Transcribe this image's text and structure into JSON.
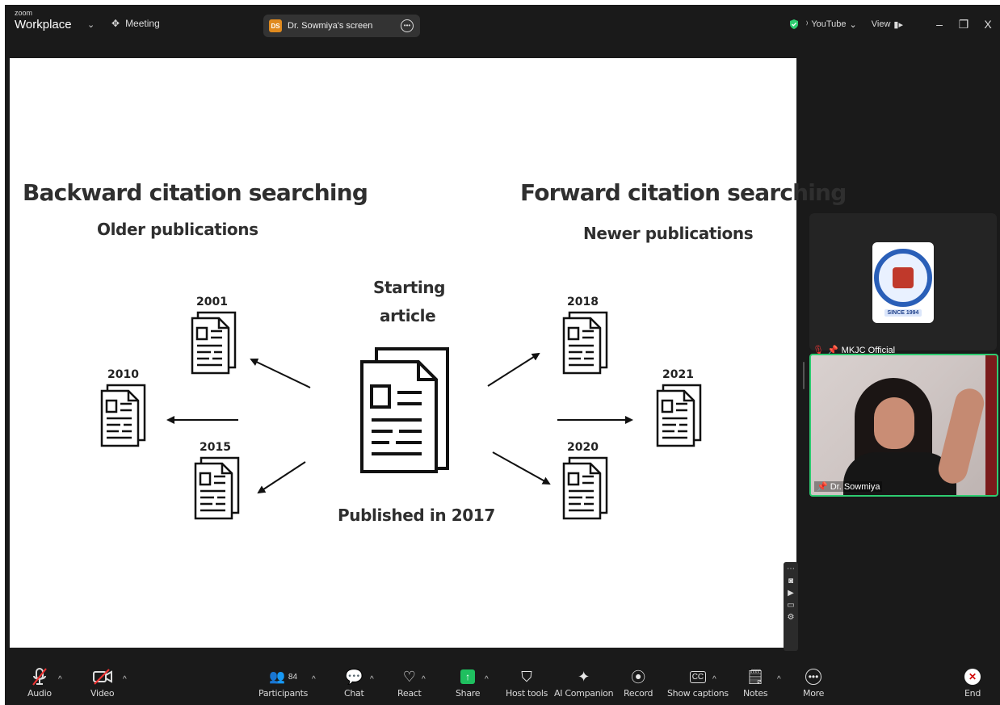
{
  "titlebar": {
    "brand_small": "zoom",
    "brand_large": "Workplace",
    "meeting_label": "Meeting",
    "screen_avatar": "DS",
    "screen_label": "Dr. Sowmiya's screen",
    "stream_label": "YouTube",
    "view_label": "View",
    "minimize": "–",
    "restore": "❐",
    "close": "X"
  },
  "slide": {
    "backward_title": "Backward citation searching",
    "backward_sub": "Older publications",
    "forward_title": "Forward citation searching",
    "forward_sub": "Newer publications",
    "starting_line1": "Starting",
    "starting_line2": "article",
    "published": "Published in 2017",
    "years": {
      "y2001": "2001",
      "y2010": "2010",
      "y2015": "2015",
      "y2018": "2018",
      "y2021": "2021",
      "y2020": "2020"
    }
  },
  "participants": {
    "tile1_name": "MKJC Official",
    "logo_text": "SINCE 1994",
    "tile2_name": "Dr. Sowmiya"
  },
  "toolbar": {
    "audio": "Audio",
    "video": "Video",
    "participants": "Participants",
    "participants_count": "84",
    "chat": "Chat",
    "react": "React",
    "share": "Share",
    "host_tools": "Host tools",
    "ai_companion": "AI Companion",
    "record": "Record",
    "show_captions": "Show captions",
    "notes": "Notes",
    "more": "More",
    "end": "End"
  },
  "colors": {
    "active_speaker": "#2ecc71",
    "share_green": "#1fbf5f",
    "end_red": "#d10000"
  }
}
